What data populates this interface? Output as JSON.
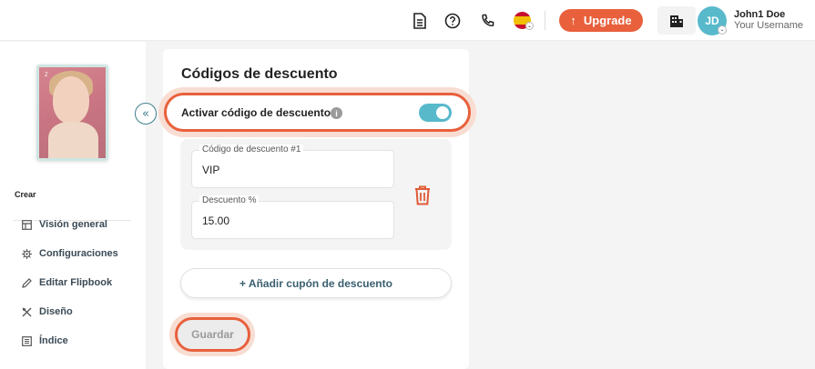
{
  "header": {
    "upgrade_label": "Upgrade",
    "user_name": "John1 Doe",
    "user_subtitle": "Your Username",
    "avatar_initials": "JD",
    "icons": [
      "document-icon",
      "help-icon",
      "phone-icon",
      "spain-flag-icon",
      "building-icon"
    ]
  },
  "sidebar": {
    "section_label": "Crear",
    "items": [
      {
        "label": "Visión general",
        "icon": "layout-icon"
      },
      {
        "label": "Configuraciones",
        "icon": "gear-icon"
      },
      {
        "label": "Editar Flipbook",
        "icon": "pencil-icon"
      },
      {
        "label": "Diseño",
        "icon": "design-tools-icon"
      },
      {
        "label": "Índice",
        "icon": "list-icon"
      }
    ]
  },
  "panel": {
    "title": "Códigos de descuento",
    "toggle_label": "Activar código de descuento",
    "toggle_on": true,
    "coupon": {
      "code_label": "Código de descuento #1",
      "code_value": "VIP",
      "discount_label": "Descuento %",
      "discount_value": "15.00"
    },
    "add_coupon_label": "+ Añadir cupón de descuento",
    "save_label": "Guardar"
  },
  "colors": {
    "accent_orange": "#e8603c",
    "teal": "#58b9cb",
    "nav_text": "#3b4a55"
  }
}
